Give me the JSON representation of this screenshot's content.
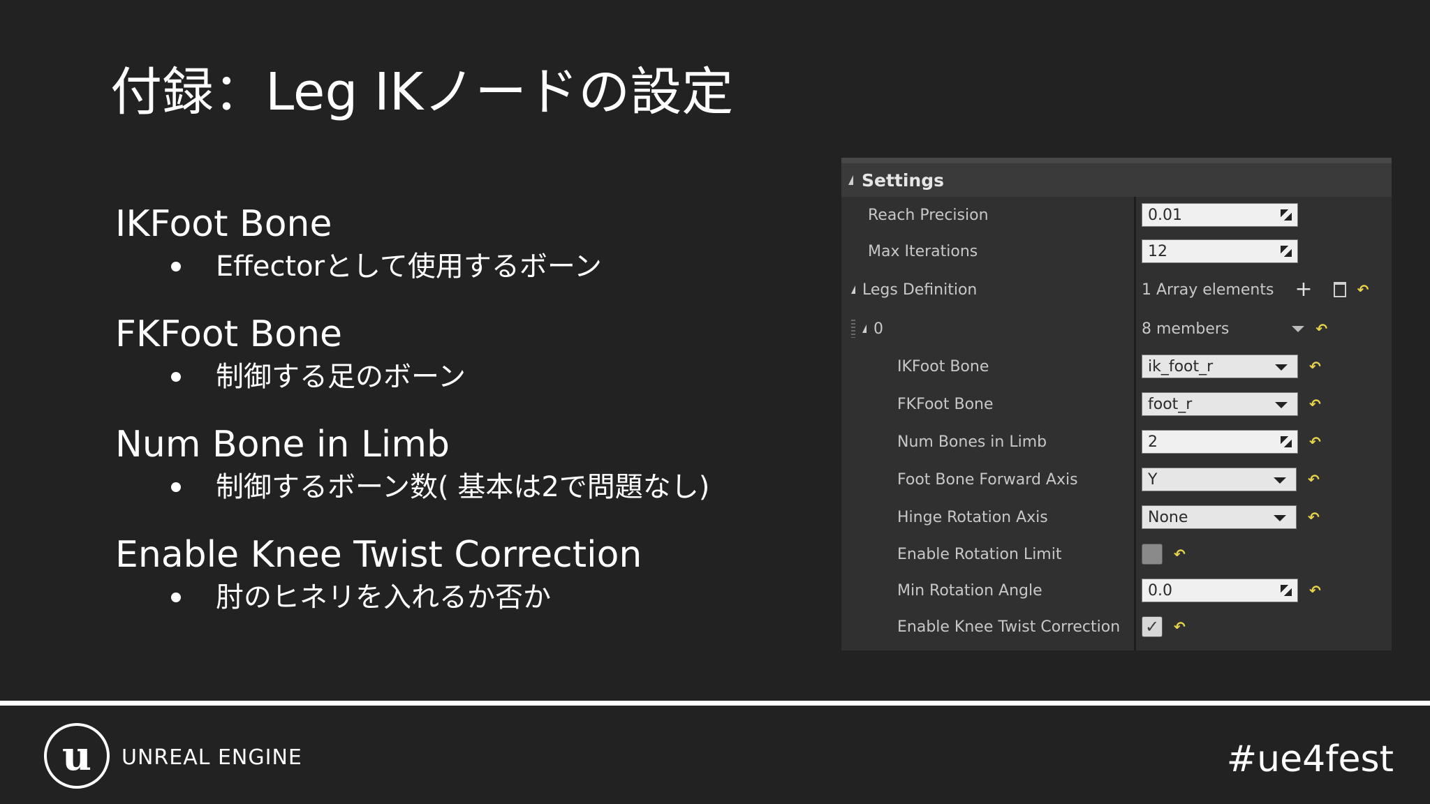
{
  "slide": {
    "title": "付録：Leg IKノードの設定",
    "sections": [
      {
        "heading": "IKFoot Bone",
        "bullet": "Effectorとして使用するボーン"
      },
      {
        "heading": "FKFoot Bone",
        "bullet": "制御する足のボーン"
      },
      {
        "heading": "Num Bone in Limb",
        "bullet": "制御するボーン数( 基本は2で問題なし)"
      },
      {
        "heading": "Enable Knee Twist Correction",
        "bullet": "肘のヒネリを入れるか否か"
      }
    ]
  },
  "panel": {
    "header": "Settings",
    "reach_precision": {
      "label": "Reach Precision",
      "value": "0.01"
    },
    "max_iterations": {
      "label": "Max Iterations",
      "value": "12"
    },
    "legs_definition": {
      "label": "Legs Definition",
      "value": "1 Array elements",
      "add_icon": "plus-icon",
      "delete_icon": "trash-icon"
    },
    "element0": {
      "label": "0",
      "value": "8 members"
    },
    "ikfoot_bone": {
      "label": "IKFoot Bone",
      "value": "ik_foot_r"
    },
    "fkfoot_bone": {
      "label": "FKFoot Bone",
      "value": "foot_r"
    },
    "num_bones": {
      "label": "Num Bones in Limb",
      "value": "2"
    },
    "forward_axis": {
      "label": "Foot Bone Forward Axis",
      "value": "Y"
    },
    "hinge_axis": {
      "label": "Hinge Rotation Axis",
      "value": "None"
    },
    "enable_rotation_limit": {
      "label": "Enable Rotation Limit",
      "checked": false
    },
    "min_rotation_angle": {
      "label": "Min Rotation Angle",
      "value": "0.0"
    },
    "enable_knee_twist": {
      "label": "Enable Knee Twist Correction",
      "checked": true
    },
    "reset_glyph": "↶"
  },
  "footer": {
    "brand": "UNREAL ENGINE",
    "logo_letter": "u",
    "hashtag": "#ue4fest"
  },
  "colors": {
    "background": "#222222",
    "panel": "#303030",
    "reset": "#e8d44a"
  }
}
